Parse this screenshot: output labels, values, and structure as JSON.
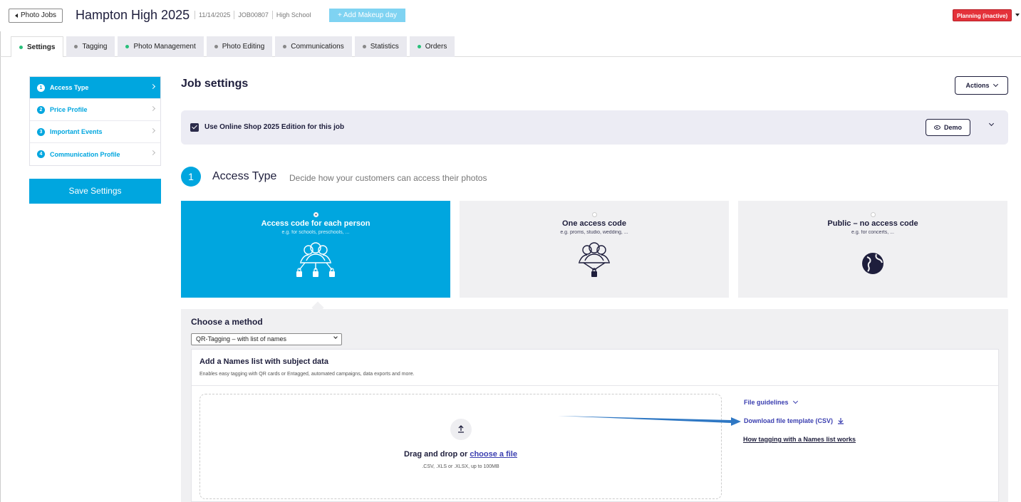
{
  "header": {
    "back_label": "Photo Jobs",
    "job_title": "Hampton High 2025",
    "date": "11/14/2025",
    "job_code": "JOB00807",
    "job_type": "High School",
    "makeup_label": "+ Add Makeup day",
    "status": "Planning (inactive)"
  },
  "tabs": [
    {
      "label": "Settings",
      "dot": "green"
    },
    {
      "label": "Tagging",
      "dot": "gray"
    },
    {
      "label": "Photo Management",
      "dot": "green"
    },
    {
      "label": "Photo Editing",
      "dot": "gray"
    },
    {
      "label": "Communications",
      "dot": "gray"
    },
    {
      "label": "Statistics",
      "dot": "gray"
    },
    {
      "label": "Orders",
      "dot": "green"
    }
  ],
  "steps": [
    {
      "num": "1",
      "label": "Access Type"
    },
    {
      "num": "2",
      "label": "Price Profile"
    },
    {
      "num": "3",
      "label": "Important Events"
    },
    {
      "num": "4",
      "label": "Communication Profile"
    }
  ],
  "save_label": "Save Settings",
  "main": {
    "title": "Job settings",
    "actions_label": "Actions",
    "shop_label": "Use Online Shop 2025 Edition for this job",
    "demo_label": "Demo",
    "section_num": "1",
    "section_title": "Access Type",
    "section_sub": "Decide how your customers can access their photos"
  },
  "access_options": [
    {
      "title": "Access code for each person",
      "sub": "e.g. for schools, preschools, ..."
    },
    {
      "title": "One access code",
      "sub": "e.g. proms, studio, wedding, ..."
    },
    {
      "title": "Public – no access code",
      "sub": "e.g. for concerts, ..."
    }
  ],
  "method": {
    "title": "Choose a method",
    "selected": "QR-Tagging – with list of names",
    "names_title": "Add a Names list with subject data",
    "names_desc": "Enables easy tagging with QR cards or Entagged, automated campaigns, data exports and more.",
    "drop_text": "Drag and drop or",
    "choose_link": "choose a file",
    "drop_hint": ".CSV, .XLS or .XLSX, up to 100MB",
    "file_guidelines": "File guidelines",
    "download_template": "Download file template (CSV)",
    "how_link": "How tagging with a Names list works"
  },
  "colors": {
    "accent": "#00a6df",
    "status": "#e4323a",
    "link": "#3b3fb0",
    "arrow": "#2f78c4"
  },
  "icons": {
    "back": "triangle-left-icon",
    "check": "checkbox-checked-icon",
    "eye": "eye-icon",
    "upload": "upload-icon",
    "download": "download-icon",
    "group-locks": "group-with-locks-icon",
    "group-lock": "group-with-lock-icon",
    "globe": "globe-icon"
  }
}
